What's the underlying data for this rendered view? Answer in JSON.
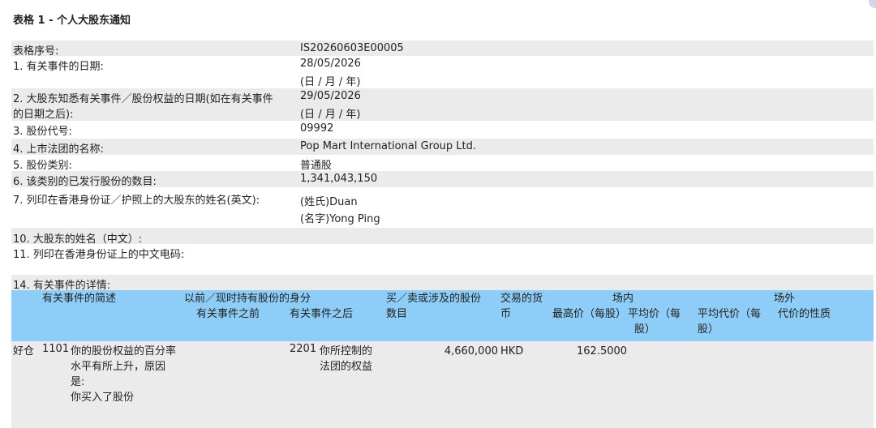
{
  "title": "表格 1 - 个人大股东通知",
  "fields": {
    "f0_label": "表格序号:",
    "f0_value": "IS20260603E00005",
    "f1_label": "1. 有关事件的日期:",
    "f1_value": "28/05/2026",
    "f1_note": "(日 / 月 / 年)",
    "f2_label_1": "2. 大股东知悉有关事件／股份权益的日期(如在有关事件",
    "f2_label_2": "的日期之后):",
    "f2_value": "29/05/2026",
    "f2_note": "(日 / 月 / 年)",
    "f3_label": "3. 股份代号:",
    "f3_value": "09992",
    "f4_label": "4. 上市法团的名称:",
    "f4_value": "Pop Mart International Group Ltd.",
    "f5_label": "5. 股份类别:",
    "f5_value": "普通股",
    "f6_label": "6. 该类别的已发行股份的数目:",
    "f6_value": "1,341,043,150",
    "f7_label": "7. 列印在香港身份证／护照上的大股东的姓名(英文):",
    "f7_surname": "(姓氏)Duan",
    "f7_given": "(名字)Yong Ping",
    "f10_label": "10. 大股东的姓名（中文）:",
    "f11_label": "11. 列印在香港身份证上的中文电码:",
    "f14_label": "14. 有关事件的详情:"
  },
  "table": {
    "h_event": "有关事件的简述",
    "h_capacity": "以前／现时持有股份的身分",
    "h_before": "有关事件之前",
    "h_after": "有关事件之后",
    "h_shares_1": "买／卖或涉及的股份",
    "h_shares_2": "数目",
    "h_currency_1": "交易的货",
    "h_currency_2": "币",
    "h_onex": "场内",
    "h_high": "最高价（每股）",
    "h_avg_1": "平均价（每",
    "h_avg_2": "股）",
    "h_offex": "场外",
    "h_off_avg_1": "平均代价（每",
    "h_off_avg_2": "股）",
    "h_nature": "代价的性质",
    "row": {
      "position": "好仓",
      "code": "1101",
      "desc_1": "你的股份权益的百分率",
      "desc_2": "水平有所上升，原因",
      "desc_3": "是:",
      "desc_4": "你买入了股份",
      "after_code": "2201",
      "after_1": "你所控制的",
      "after_2": "法团的权益",
      "shares": "4,660,000",
      "currency": "HKD",
      "high": "162.5000"
    }
  }
}
